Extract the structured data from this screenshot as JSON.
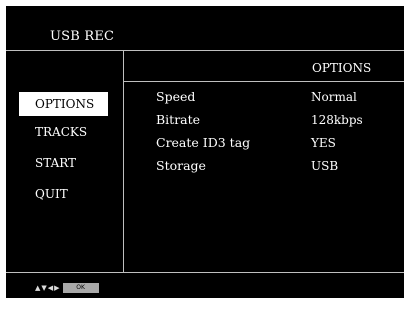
{
  "header": {
    "title": "USB REC"
  },
  "panel": {
    "title": "OPTIONS"
  },
  "menu": {
    "items": [
      {
        "label": "OPTIONS"
      },
      {
        "label": "TRACKS"
      },
      {
        "label": "START"
      },
      {
        "label": "QUIT"
      }
    ],
    "selected": "OPTIONS"
  },
  "settings": {
    "rows": [
      {
        "label": "Speed",
        "value": "Normal"
      },
      {
        "label": "Bitrate",
        "value": "128kbps"
      },
      {
        "label": "Create ID3 tag",
        "value": "YES"
      },
      {
        "label": "Storage",
        "value": "USB"
      }
    ]
  },
  "footer": {
    "icons": [
      "up-arrow-icon",
      "down-arrow-icon",
      "left-arrow-icon",
      "right-arrow-icon"
    ],
    "ok_label": "OK"
  },
  "colors": {
    "background": "#000000",
    "text": "#ffffff",
    "selected_background": "#ffffff",
    "selected_text": "#000000",
    "divider": "#bfbfbf",
    "ok_key": "#a9a9a9"
  }
}
